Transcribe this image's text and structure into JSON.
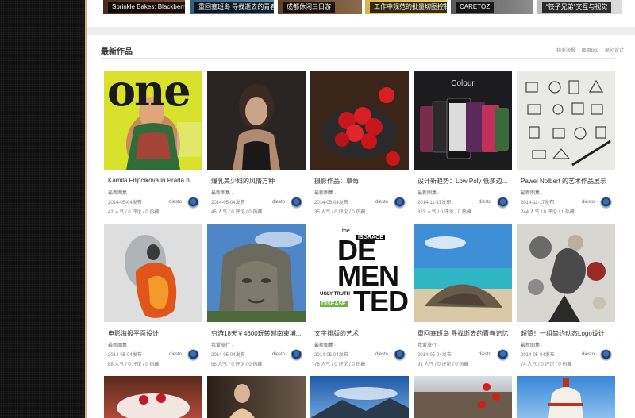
{
  "top_strip": [
    {
      "caption": "Sprinkle Bakes: Blackberry",
      "bg": "#5a3a2a"
    },
    {
      "caption": "重回塞班岛 寻找逝去的青春",
      "bg": "#3a6a8a"
    },
    {
      "caption": "成都休闲三日游",
      "bg": "#6b4a2e"
    },
    {
      "caption": "工作中规范的批量切图控制",
      "bg": "#c8a43a"
    },
    {
      "caption": "CARETOZ",
      "bg": "#7a7a7a"
    },
    {
      "caption": "“筷子兄弟”交互与视觉",
      "bg": "#a8a8a8"
    }
  ],
  "section": {
    "title": "最新作品",
    "links": [
      "精美海报",
      "图酒psd",
      "原创设计"
    ]
  },
  "cards": [
    {
      "title": "Kamila Filipcikova in Prada b...",
      "category": "最新图集 ·",
      "date": "2014-05-04发布",
      "stats": "42 人气 / 0 评论 / 0 热藏",
      "author": "diesto",
      "thumb": "magazine-cover-image",
      "thumb_text": "one"
    },
    {
      "title": "爆乳美少妇的风情万种",
      "category": "最新图集 ·",
      "date": "2014-05-04发布",
      "stats": "45 人气 / 0 评论 / 0 热藏",
      "author": "diesto",
      "thumb": "portrait-woman-image"
    },
    {
      "title": "摄影作品：草莓",
      "category": "最新图集 ·",
      "date": "2014-05-04发布",
      "stats": "35 人气 / 0 评论 / 0 热藏",
      "author": "diesto",
      "thumb": "strawberries-image"
    },
    {
      "title": "设计新趋势：Low Poly 低多边...",
      "category": "最新图集 ·",
      "date": "2014-11-17发布",
      "stats": "323 人气 / 0 评论 / 0 热藏",
      "author": "diesto",
      "thumb": "phones-colour-image",
      "thumb_text": "Colour"
    },
    {
      "title": "Pawel Nolbert 的艺术作品展示",
      "category": "最新图集 ·",
      "date": "2014-11-17发布",
      "stats": "244 人气 / 0 评论 / 1 热藏",
      "author": "diesto",
      "thumb": "sketch-icons-image"
    },
    {
      "title": "电影海报平面设计",
      "category": "最新图集 ·",
      "date": "2014-05-04发布",
      "stats": "88 人气 / 0 评论 / 0 热藏",
      "author": "diesto",
      "thumb": "fire-poster-image"
    },
    {
      "title": "穷游18天￥4600玩转越南柬埔...",
      "category": "我爱旅行 ·",
      "date": "2014-05-04发布",
      "stats": "55 人气 / 0 评论 / 0 热藏",
      "author": "diesto",
      "thumb": "stone-face-temple-image"
    },
    {
      "title": "文字排版的艺术",
      "category": "最新图集 ·",
      "date": "2014-05-04发布",
      "stats": "76 人气 / 0 评论 / 0 热藏",
      "author": "diesto",
      "thumb": "typography-poster-image",
      "thumb_text": [
        "DE",
        "MEN",
        "TED"
      ],
      "thumb_small": [
        "the",
        "ISGRACE",
        "UGLY TRUTH",
        "DISEASE"
      ]
    },
    {
      "title": "重回塞班岛 寻找逝去的青春记忆",
      "category": "我爱旅行 ·",
      "date": "2014-05-04发布",
      "stats": "91 人气 / 0 评论 / 0 热藏",
      "author": "diesto",
      "thumb": "beach-rocks-image"
    },
    {
      "title": "超赞！一组简约动态Logo设计",
      "category": "最新图集 ·",
      "date": "2014-05-04发布",
      "stats": "74 人气 / 0 评论 / 0 热藏",
      "author": "diesto",
      "thumb": "collage-art-image"
    }
  ],
  "bottom_thumbs": [
    "cake-image",
    "woman-bar-image",
    "sky-mountain-image",
    "street-market-image",
    "building-dome-image"
  ]
}
